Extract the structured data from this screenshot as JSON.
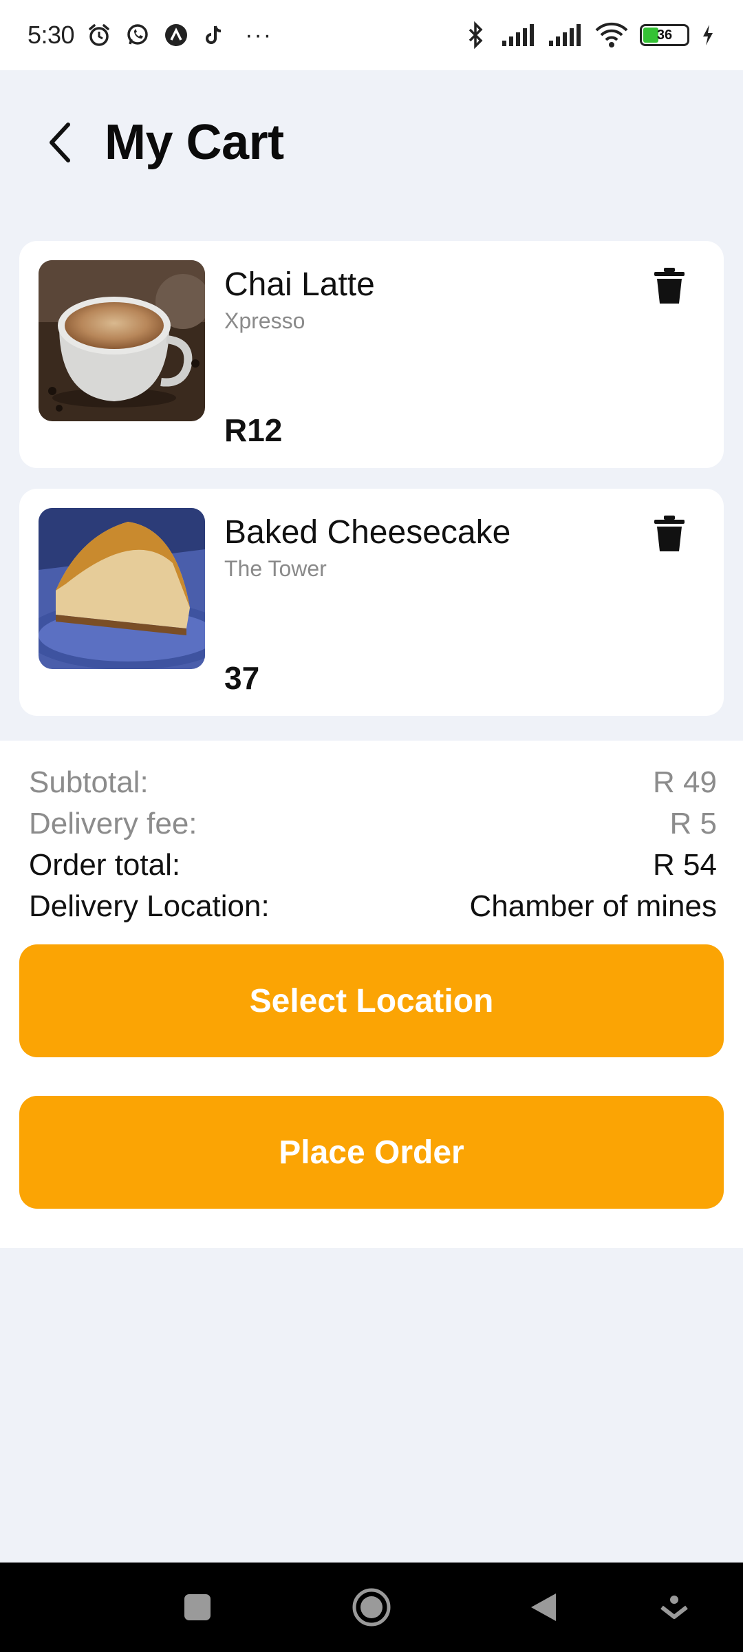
{
  "status_bar": {
    "time": "5:30",
    "overflow": "···",
    "battery_level": "36",
    "left_icons": [
      "alarm-icon",
      "whatsapp-icon",
      "app-icon",
      "tiktok-icon"
    ],
    "right_icons": [
      "bluetooth-icon",
      "signal-icon",
      "signal-icon",
      "wifi-icon",
      "battery-icon",
      "charging-icon"
    ]
  },
  "header": {
    "title": "My Cart",
    "back_icon": "chevron-left-icon"
  },
  "cart": {
    "items": [
      {
        "name": "Chai Latte",
        "vendor": "Xpresso",
        "price": "R12",
        "image": "chai-latte-photo"
      },
      {
        "name": "Baked Cheesecake",
        "vendor": "The Tower",
        "price": "37",
        "image": "cheesecake-photo"
      }
    ],
    "delete_icon": "trash-icon"
  },
  "summary": {
    "subtotal_label": "Subtotal:",
    "subtotal_value": "R 49",
    "delivery_fee_label": "Delivery fee:",
    "delivery_fee_value": "R 5",
    "order_total_label": "Order total:",
    "order_total_value": "R 54",
    "location_label": "Delivery Location:",
    "location_value": "Chamber of mines"
  },
  "actions": {
    "select_location": "Select Location",
    "place_order": "Place Order"
  },
  "colors": {
    "accent": "#fba404",
    "background": "#eff2f8",
    "card": "#ffffff",
    "muted_text": "#8c8c8c"
  },
  "nav_bar": {
    "icons": [
      "recents-icon",
      "home-icon",
      "back-icon",
      "assistant-icon"
    ]
  }
}
